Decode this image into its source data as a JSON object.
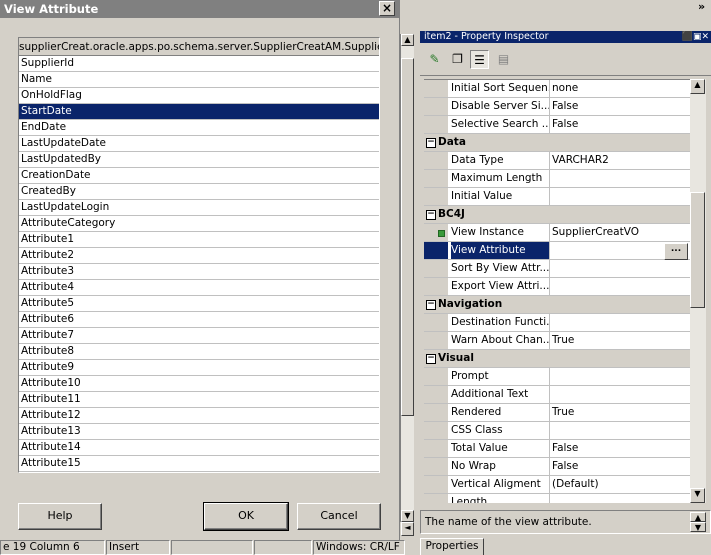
{
  "dialog": {
    "title": "View Attribute",
    "close_glyph": "×",
    "list_header": "supplierCreat.oracle.apps.po.schema.server.SupplierCreatAM.Supplier...",
    "attributes": [
      "SupplierId",
      "Name",
      "OnHoldFlag",
      "StartDate",
      "EndDate",
      "LastUpdateDate",
      "LastUpdatedBy",
      "CreationDate",
      "CreatedBy",
      "LastUpdateLogin",
      "AttributeCategory",
      "Attribute1",
      "Attribute2",
      "Attribute3",
      "Attribute4",
      "Attribute5",
      "Attribute6",
      "Attribute7",
      "Attribute8",
      "Attribute9",
      "Attribute10",
      "Attribute11",
      "Attribute12",
      "Attribute13",
      "Attribute14",
      "Attribute15"
    ],
    "selected_attribute": "StartDate",
    "buttons": {
      "help": "Help",
      "ok": "OK",
      "cancel": "Cancel"
    }
  },
  "statusbar": {
    "position": "e 19 Column 6",
    "mode": "Insert",
    "line_ending": "Windows: CR/LF"
  },
  "property_inspector": {
    "title": "item2 - Property Inspector",
    "title_buttons": "⬛▣✕",
    "rows": [
      {
        "kind": "prop",
        "name": "Initial Sort Sequen...",
        "value": "none"
      },
      {
        "kind": "prop",
        "name": "Disable Server Si...",
        "value": "False"
      },
      {
        "kind": "prop",
        "name": "Selective Search ...",
        "value": "False"
      },
      {
        "kind": "cat",
        "name": "Data"
      },
      {
        "kind": "prop",
        "name": "Data Type",
        "value": "VARCHAR2"
      },
      {
        "kind": "prop",
        "name": "Maximum Length",
        "value": ""
      },
      {
        "kind": "prop",
        "name": "Initial Value",
        "value": ""
      },
      {
        "kind": "cat",
        "name": "BC4J"
      },
      {
        "kind": "prop",
        "name": "View Instance",
        "value": "SupplierCreatVO",
        "marked": true
      },
      {
        "kind": "prop",
        "name": "View Attribute",
        "value": "",
        "selected": true,
        "dots": "..."
      },
      {
        "kind": "prop",
        "name": "Sort By View Attr...",
        "value": ""
      },
      {
        "kind": "prop",
        "name": "Export View Attri...",
        "value": ""
      },
      {
        "kind": "cat",
        "name": "Navigation"
      },
      {
        "kind": "prop",
        "name": "Destination Functi...",
        "value": ""
      },
      {
        "kind": "prop",
        "name": "Warn About Chan...",
        "value": "True"
      },
      {
        "kind": "cat",
        "name": "Visual"
      },
      {
        "kind": "prop",
        "name": "Prompt",
        "value": ""
      },
      {
        "kind": "prop",
        "name": "Additional Text",
        "value": ""
      },
      {
        "kind": "prop",
        "name": "Rendered",
        "value": "True"
      },
      {
        "kind": "prop",
        "name": "CSS Class",
        "value": ""
      },
      {
        "kind": "prop",
        "name": "Total Value",
        "value": "False"
      },
      {
        "kind": "prop",
        "name": "No Wrap",
        "value": "False"
      },
      {
        "kind": "prop",
        "name": "Vertical Aligment",
        "value": "(Default)"
      },
      {
        "kind": "prop",
        "name": "Length",
        "value": ""
      }
    ],
    "description": "The name of the view attribute.",
    "tab_label": "Properties",
    "collapse_glyph": "−"
  },
  "chevron": "»"
}
